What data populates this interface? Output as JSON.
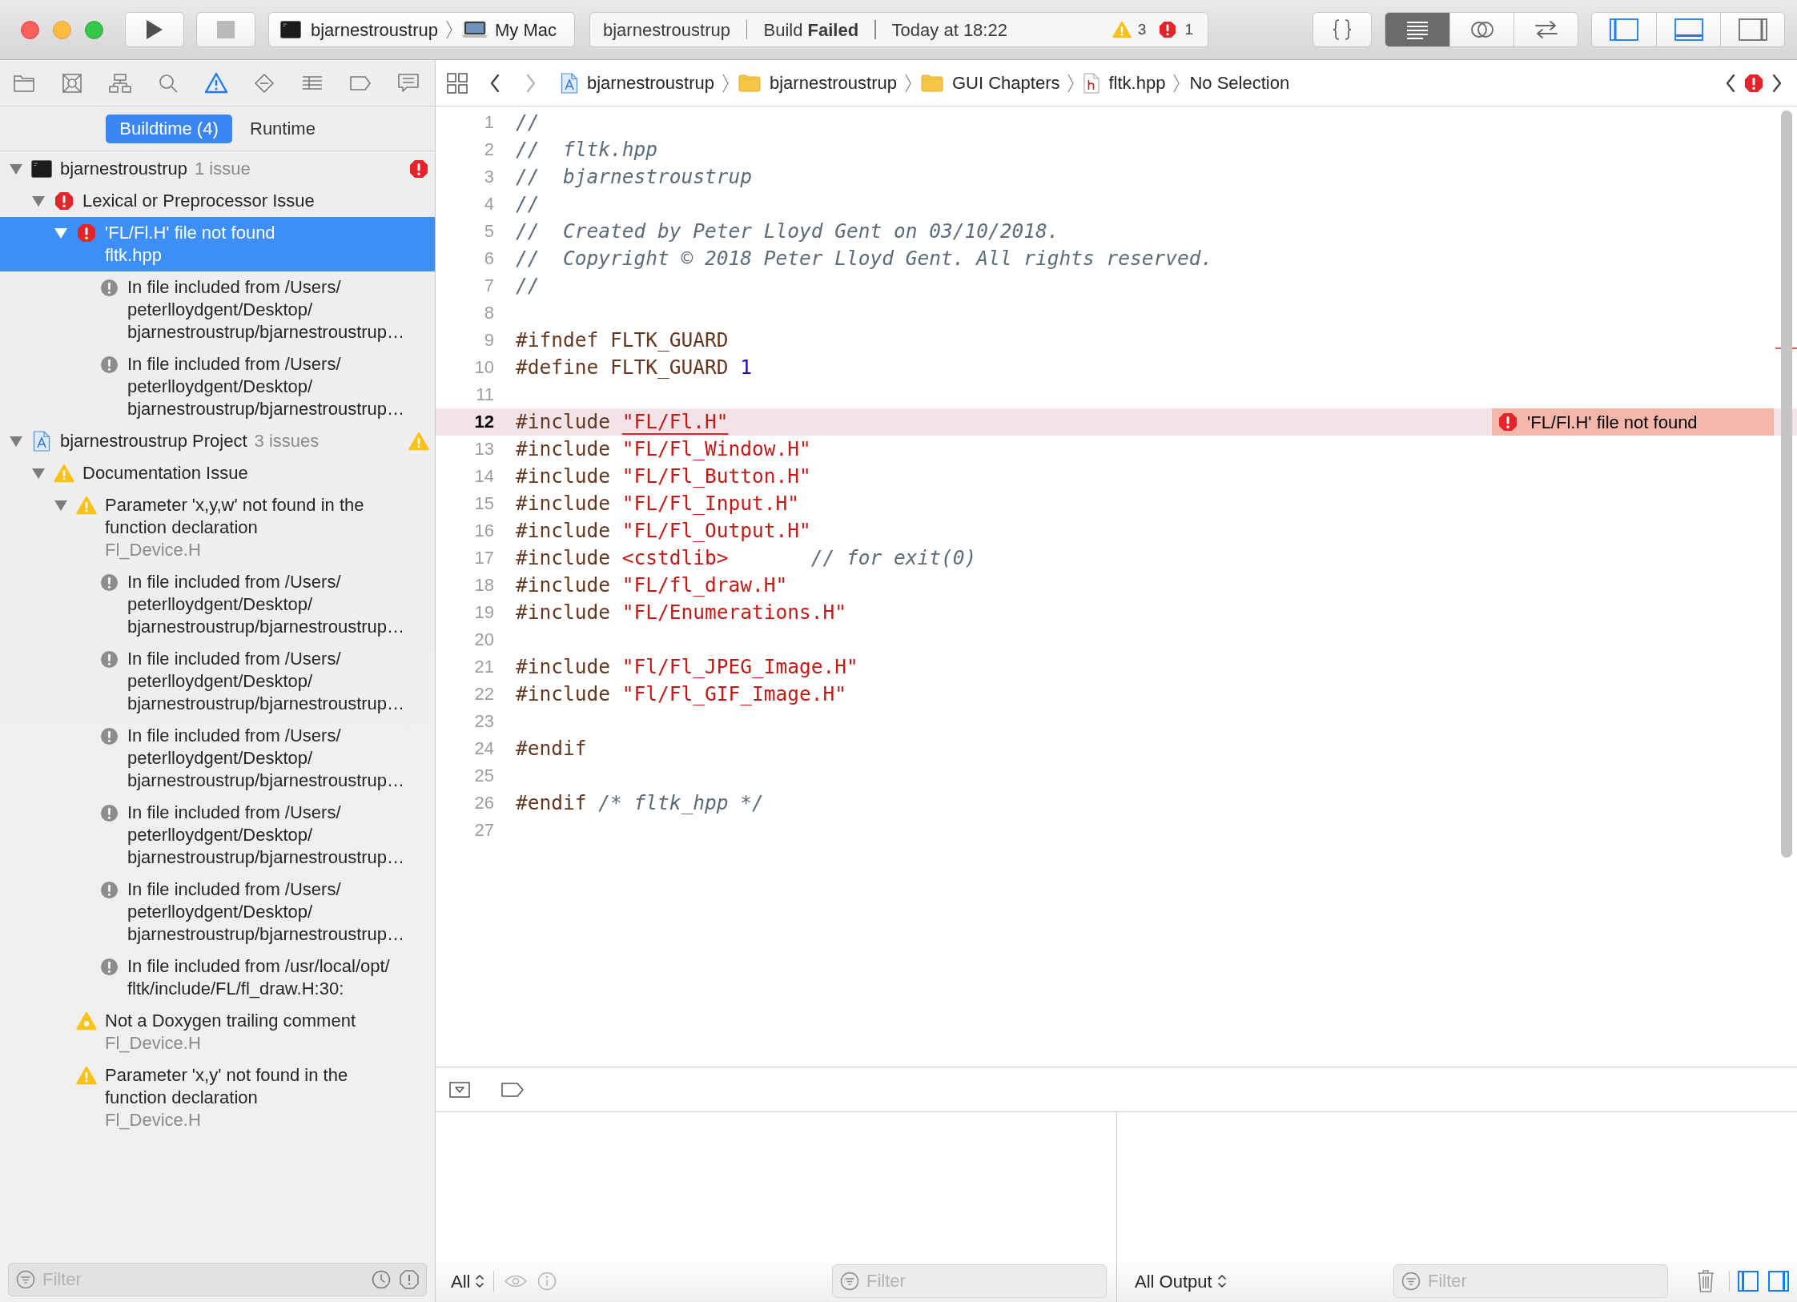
{
  "toolbar": {
    "buttons": [
      {
        "kind": "run",
        "disabled": false
      },
      {
        "kind": "stop",
        "disabled": true
      }
    ],
    "scheme": {
      "target": "bjarnestroustrup",
      "destination": "My Mac"
    },
    "activity": {
      "project": "bjarnestroustrup",
      "status": "Build **Failed**",
      "time": "Today at 18:22",
      "warnings": "3",
      "errors": "1"
    },
    "editor_modes": [
      {
        "kind": "standard",
        "selected": true
      },
      {
        "kind": "assistant",
        "selected": false
      },
      {
        "kind": "version",
        "selected": false
      }
    ],
    "panels": [
      {
        "kind": "navigator",
        "on": true
      },
      {
        "kind": "debug",
        "on": true
      },
      {
        "kind": "inspector",
        "on": false
      }
    ]
  },
  "navigator": {
    "tabs": [
      {
        "kind": "project",
        "selected": false
      },
      {
        "kind": "source_control",
        "selected": false
      },
      {
        "kind": "symbol",
        "selected": false
      },
      {
        "kind": "find",
        "selected": false
      },
      {
        "kind": "issue",
        "selected": true
      },
      {
        "kind": "test",
        "selected": false
      },
      {
        "kind": "debug",
        "selected": false
      },
      {
        "kind": "breakpoint",
        "selected": false
      },
      {
        "kind": "report",
        "selected": false
      }
    ],
    "scopes": [
      {
        "label": "Buildtime (4)",
        "selected": true
      },
      {
        "label": "Runtime",
        "selected": false
      }
    ],
    "issues": [
      {
        "kind": "target",
        "title": "bjarnestroustrup",
        "count": "1 issue",
        "expanded": true,
        "selected": false,
        "children": [
          {
            "kind": "error",
            "title": "Lexical or Preprocessor Issue",
            "expanded": true,
            "selected": false,
            "children": [
              {
                "kind": "error",
                "title": "'FL/Fl.H' file not found",
                "file": "fltk.hpp",
                "expanded": true,
                "selected": true,
                "children": [
                  {
                    "kind": "note",
                    "text": "In file included from /Users/\npeterlloydgent/Desktop/\nbjarnestroustrup/bjarnestroustrup…",
                    "selected": false
                  },
                  {
                    "kind": "note",
                    "text": "In file included from /Users/\npeterlloydgent/Desktop/\nbjarnestroustrup/bjarnestroustrup…",
                    "selected": false
                  }
                ]
              }
            ]
          }
        ]
      },
      {
        "kind": "project",
        "title": "bjarnestroustrup Project",
        "count": "3 issues",
        "expanded": true,
        "selected": false,
        "children": [
          {
            "kind": "warning",
            "title": "Documentation Issue",
            "expanded": true,
            "selected": false,
            "children": [
              {
                "kind": "warning",
                "title": "Parameter 'x,y,w' not found in the\nfunction declaration",
                "file": "Fl_Device.H",
                "expanded": true,
                "selected": false,
                "children": [
                  {
                    "kind": "note",
                    "text": "In file included from /Users/\npeterlloydgent/Desktop/\nbjarnestroustrup/bjarnestroustrup…",
                    "selected": false
                  },
                  {
                    "kind": "note",
                    "text": "In file included from /Users/\npeterlloydgent/Desktop/\nbjarnestroustrup/bjarnestroustrup…",
                    "selected": false
                  },
                  {
                    "kind": "note",
                    "text": "In file included from /Users/\npeterlloydgent/Desktop/\nbjarnestroustrup/bjarnestroustrup…",
                    "selected": false
                  },
                  {
                    "kind": "note",
                    "text": "In file included from /Users/\npeterlloydgent/Desktop/\nbjarnestroustrup/bjarnestroustrup…",
                    "selected": false
                  },
                  {
                    "kind": "note",
                    "text": "In file included from /Users/\npeterlloydgent/Desktop/\nbjarnestroustrup/bjarnestroustrup…",
                    "selected": false
                  },
                  {
                    "kind": "note",
                    "text": "In file included from /usr/local/opt/\nfltk/include/FL/fl_draw.H:30:",
                    "selected": false
                  }
                ]
              },
              {
                "kind": "notice",
                "title": "Not a Doxygen trailing comment",
                "file": "Fl_Device.H",
                "selected": false
              },
              {
                "kind": "warning",
                "title": "Parameter 'x,y' not found in the\nfunction declaration",
                "file": "Fl_Device.H",
                "selected": false
              }
            ]
          }
        ]
      }
    ],
    "filter": {
      "placeholder": "Filter"
    }
  },
  "editor": {
    "history": [
      {
        "kind": "back",
        "disabled": false
      },
      {
        "kind": "forward",
        "disabled": true
      }
    ],
    "path": [
      {
        "kind": "project",
        "label": "bjarnestroustrup"
      },
      {
        "kind": "folder",
        "label": "bjarnestroustrup"
      },
      {
        "kind": "folder",
        "label": "GUI Chapters"
      },
      {
        "kind": "header",
        "label": "fltk.hpp"
      },
      {
        "kind": "none",
        "label": "No Selection"
      }
    ],
    "lines": [
      {
        "number": "1",
        "error": false,
        "tokens": [
          {
            "kind": "comment",
            "text": "//"
          }
        ]
      },
      {
        "number": "2",
        "error": false,
        "tokens": [
          {
            "kind": "comment",
            "text": "//  fltk.hpp"
          }
        ]
      },
      {
        "number": "3",
        "error": false,
        "tokens": [
          {
            "kind": "comment",
            "text": "//  bjarnestroustrup"
          }
        ]
      },
      {
        "number": "4",
        "error": false,
        "tokens": [
          {
            "kind": "comment",
            "text": "//"
          }
        ]
      },
      {
        "number": "5",
        "error": false,
        "tokens": [
          {
            "kind": "comment",
            "text": "//  Created by Peter Lloyd Gent on 03/10/2018."
          }
        ]
      },
      {
        "number": "6",
        "error": false,
        "tokens": [
          {
            "kind": "comment",
            "text": "//  Copyright © 2018 Peter Lloyd Gent. All rights reserved."
          }
        ]
      },
      {
        "number": "7",
        "error": false,
        "tokens": [
          {
            "kind": "comment",
            "text": "//"
          }
        ]
      },
      {
        "number": "8",
        "error": false
      },
      {
        "number": "9",
        "error": false,
        "tokens": [
          {
            "kind": "preproc",
            "text": "#ifndef FLTK_GUARD"
          }
        ]
      },
      {
        "number": "10",
        "error": false,
        "tokens": [
          {
            "kind": "preproc",
            "text": "#define FLTK_GUARD "
          },
          {
            "kind": "number",
            "text": "1"
          }
        ]
      },
      {
        "number": "11",
        "error": false
      },
      {
        "number": "12",
        "error": true,
        "tokens": [
          {
            "kind": "preproc",
            "text": "#include "
          },
          {
            "kind": "string",
            "text": "\"FL/Fl.H\""
          }
        ],
        "annotation": "'FL/Fl.H' file not found"
      },
      {
        "number": "13",
        "error": false,
        "tokens": [
          {
            "kind": "preproc",
            "text": "#include "
          },
          {
            "kind": "string",
            "text": "\"FL/Fl_Window.H\""
          }
        ]
      },
      {
        "number": "14",
        "error": false,
        "tokens": [
          {
            "kind": "preproc",
            "text": "#include "
          },
          {
            "kind": "string",
            "text": "\"FL/Fl_Button.H\""
          }
        ]
      },
      {
        "number": "15",
        "error": false,
        "tokens": [
          {
            "kind": "preproc",
            "text": "#include "
          },
          {
            "kind": "string",
            "text": "\"FL/Fl_Input.H\""
          }
        ]
      },
      {
        "number": "16",
        "error": false,
        "tokens": [
          {
            "kind": "preproc",
            "text": "#include "
          },
          {
            "kind": "string",
            "text": "\"FL/Fl_Output.H\""
          }
        ]
      },
      {
        "number": "17",
        "error": false,
        "tokens": [
          {
            "kind": "preproc",
            "text": "#include "
          },
          {
            "kind": "string",
            "text": "<cstdlib>"
          },
          {
            "kind": "comment",
            "text": "       // for exit(0)"
          }
        ]
      },
      {
        "number": "18",
        "error": false,
        "tokens": [
          {
            "kind": "preproc",
            "text": "#include "
          },
          {
            "kind": "string",
            "text": "\"FL/fl_draw.H\""
          }
        ]
      },
      {
        "number": "19",
        "error": false,
        "tokens": [
          {
            "kind": "preproc",
            "text": "#include "
          },
          {
            "kind": "string",
            "text": "\"FL/Enumerations.H\""
          }
        ]
      },
      {
        "number": "20",
        "error": false
      },
      {
        "number": "21",
        "error": false,
        "tokens": [
          {
            "kind": "preproc",
            "text": "#include "
          },
          {
            "kind": "string",
            "text": "\"Fl/Fl_JPEG_Image.H\""
          }
        ]
      },
      {
        "number": "22",
        "error": false,
        "tokens": [
          {
            "kind": "preproc",
            "text": "#include "
          },
          {
            "kind": "string",
            "text": "\"Fl/Fl_GIF_Image.H\""
          }
        ]
      },
      {
        "number": "23",
        "error": false
      },
      {
        "number": "24",
        "error": false,
        "tokens": [
          {
            "kind": "preproc",
            "text": "#endif"
          }
        ]
      },
      {
        "number": "25",
        "error": false
      },
      {
        "number": "26",
        "error": false,
        "tokens": [
          {
            "kind": "preproc",
            "text": "#endif "
          },
          {
            "kind": "comment",
            "text": "/* fltk_hpp */"
          }
        ]
      },
      {
        "number": "27",
        "error": false
      }
    ]
  },
  "debug": {
    "variables": {
      "scope": "All",
      "filter": {
        "placeholder": "Filter"
      }
    },
    "console": {
      "output": "All Output",
      "filter": {
        "placeholder": "Filter"
      }
    },
    "panes": [
      {
        "kind": "variables",
        "on": true
      },
      {
        "kind": "console",
        "on": true
      }
    ]
  }
}
